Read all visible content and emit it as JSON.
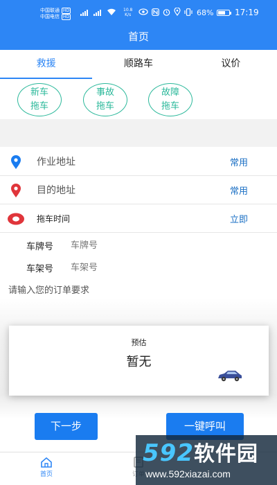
{
  "status_bar": {
    "carrier_1": "中国联通",
    "carrier_2": "中国电信",
    "hd": "HD",
    "network": "4G",
    "speed_value": "10.8",
    "speed_unit": "K/s",
    "battery_percent": "68%",
    "battery_level": 0.68,
    "time": "17:19"
  },
  "header": {
    "title": "首页"
  },
  "tabs": [
    {
      "label": "救援",
      "active": true
    },
    {
      "label": "顺路车",
      "active": false
    },
    {
      "label": "议价",
      "active": false
    }
  ],
  "services": [
    {
      "line1": "新车",
      "line2": "拖车"
    },
    {
      "line1": "事故",
      "line2": "拖车"
    },
    {
      "line1": "故障",
      "line2": "拖车"
    }
  ],
  "form": {
    "work_address": {
      "label": "作业地址",
      "action": "常用"
    },
    "destination": {
      "label": "目的地址",
      "action": "常用"
    },
    "tow_time": {
      "label": "拖车时间",
      "action": "立即"
    },
    "plate": {
      "label": "车牌号",
      "placeholder": "车牌号"
    },
    "frame": {
      "label": "车架号",
      "placeholder": "车架号"
    },
    "requirement_placeholder": "请输入您的订单要求"
  },
  "estimate": {
    "title": "预估",
    "value": "暂无"
  },
  "buttons": {
    "next": "下一步",
    "call": "一键呼叫"
  },
  "bottom_nav": [
    {
      "label": "首页",
      "icon": "home-icon",
      "active": true
    },
    {
      "label": "订单",
      "icon": "order-icon",
      "active": false
    }
  ],
  "watermark": {
    "logo_number": "592",
    "logo_text": "软件园",
    "url": "www.592xiazai.com"
  },
  "colors": {
    "primary": "#2d86f5",
    "button": "#1a7cf0",
    "service_green": "#2ab89a",
    "action_blue": "#1a6fc4"
  }
}
